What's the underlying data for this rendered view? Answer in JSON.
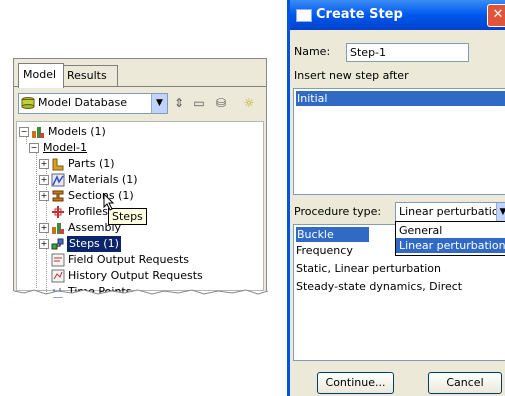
{
  "tree_panel": {
    "tabs": [
      "Model",
      "Results"
    ],
    "database_combo": "Model Database",
    "nodes": {
      "models": "Models (1)",
      "model1": "Model-1",
      "parts": "Parts (1)",
      "materials": "Materials (1)",
      "sections": "Sections (1)",
      "profiles": "Profiles",
      "assembly": "Assembly",
      "steps": "Steps (1)",
      "field_output": "Field Output Requests",
      "history_output": "History Output Requests",
      "time_points": "Time Points"
    },
    "tooltip": "Steps"
  },
  "dialog": {
    "title": "Create Step",
    "name_label": "Name:",
    "name_value": "Step-1",
    "insert_label": "Insert new step after",
    "insert_list": [
      "Initial"
    ],
    "procedure_label": "Procedure type:",
    "procedure_value": "Linear perturbation",
    "procedure_options": [
      "General",
      "Linear perturbation"
    ],
    "procedures": [
      "Buckle",
      "Frequency",
      "Static, Linear perturbation",
      "Steady-state dynamics, Direct"
    ],
    "continue_button": "Continue...",
    "cancel_button": "Cancel"
  },
  "colors": {
    "title_bar": "#0058ee",
    "selection": "#316ac5",
    "tooltip_bg": "#ffffe1"
  }
}
